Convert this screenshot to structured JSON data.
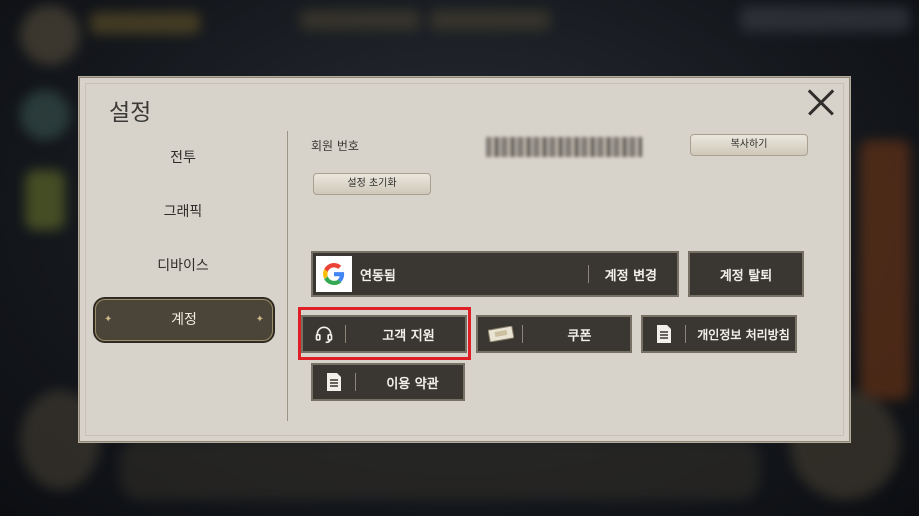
{
  "settings": {
    "title": "설정",
    "nav": [
      "전투",
      "그래픽",
      "디바이스",
      "계정"
    ],
    "active_nav": "계정",
    "member_no_label": "회원 번호",
    "copy_label": "복사하기",
    "reset_label": "설정 초기화",
    "linked_label": "연동됨",
    "change_account_label": "계정 변경",
    "delete_account_label": "계정 탈퇴",
    "support_label": "고객 지원",
    "coupon_label": "쿠폰",
    "privacy_label": "개인정보 처리방침",
    "terms_label": "이용 약관"
  },
  "colors": {
    "panel_bg": "#d8d3ca",
    "button_dark": "#3a3631",
    "highlight": "#e01e26"
  }
}
